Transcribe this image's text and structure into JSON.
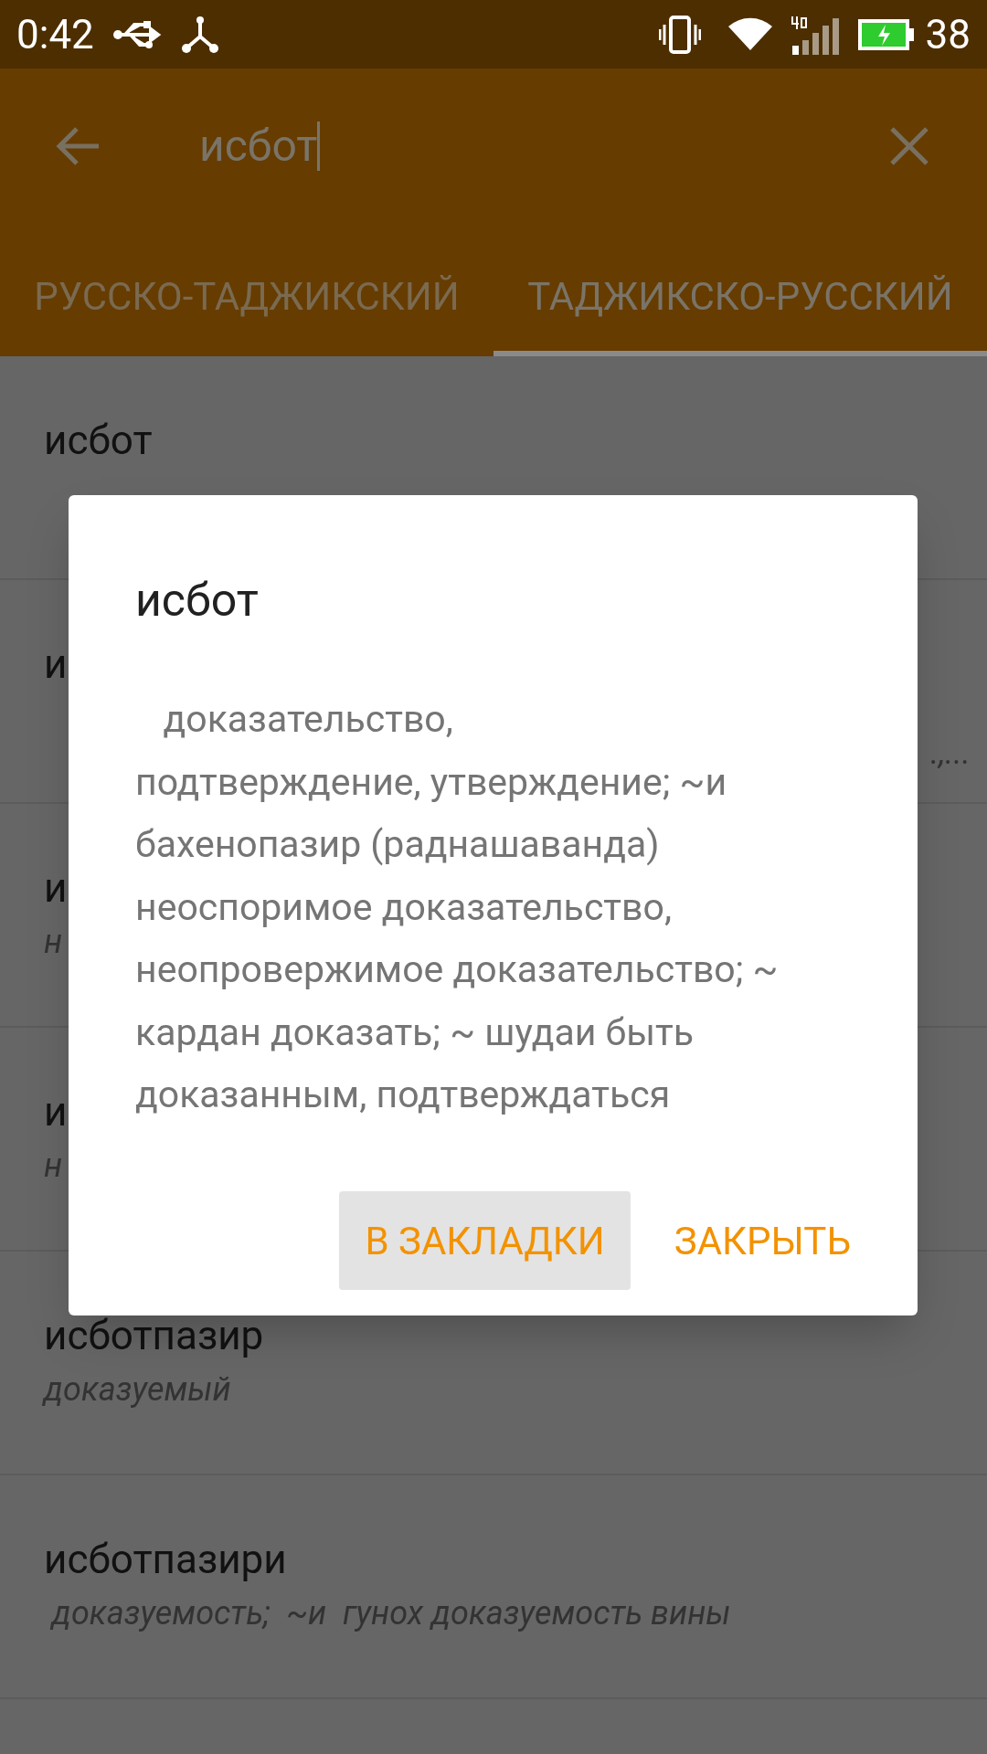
{
  "status_bar": {
    "time": "0:42",
    "battery": "38"
  },
  "search": {
    "value": "исбот"
  },
  "tabs": [
    {
      "label": "РУССКО-ТАДЖИКСКИЙ",
      "selected": false
    },
    {
      "label": "ТАДЖИКСКО-РУССКИЙ",
      "selected": true
    }
  ],
  "results": [
    {
      "word": "исбот"
    },
    {
      "word": "и",
      "meaning_end": ".,..."
    },
    {
      "word": "и",
      "meaning": "н"
    },
    {
      "word": "и",
      "meaning": "н"
    },
    {
      "word": "исботпазир",
      "meaning": "доказуемый"
    },
    {
      "word": "исботпазири",
      "meaning": " доказуемость;  ~и  гунох доказуемость вины"
    }
  ],
  "dialog": {
    "title": "исбот",
    "body": "   доказательство,\nподтверждение, утверждение; ~и бахенопазир (раднашаванда) неоспоримое доказательство, неопровержимое доказательство; ~ кардан доказать; ~ шудаи быть доказанным, подтверждаться",
    "buttons": [
      {
        "label": "В ЗАКЛАДКИ",
        "selected": true
      },
      {
        "label": "ЗАКРЫТЬ",
        "selected": false
      }
    ]
  }
}
